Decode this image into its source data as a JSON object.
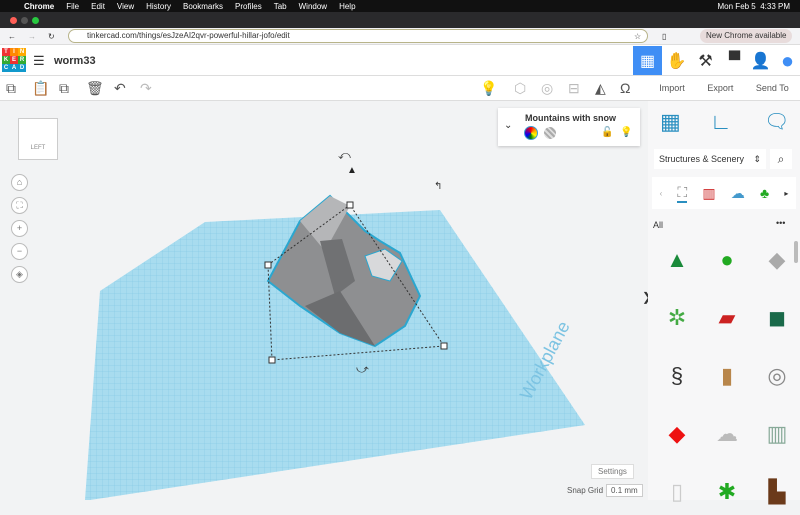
{
  "menubar": {
    "app": "Chrome",
    "items": [
      "File",
      "Edit",
      "View",
      "History",
      "Bookmarks",
      "Profiles",
      "Tab",
      "Window",
      "Help"
    ],
    "datetime": "Mon Feb 5  4:33 PM"
  },
  "browser": {
    "url": "tinkercad.com/things/esJzeAI2qvr-powerful-hillar-jofo/edit",
    "update": "New Chrome available"
  },
  "logo": [
    "T",
    "I",
    "N",
    "K",
    "E",
    "R",
    "C",
    "A",
    "D"
  ],
  "header": {
    "title": "worm33"
  },
  "right_toolbar": {
    "import": "Import",
    "export": "Export",
    "send_to": "Send To"
  },
  "inspector": {
    "name": "Mountains with snow"
  },
  "viewcube": {
    "face": "LEFT"
  },
  "workplane": {
    "label": "Workplane",
    "color": "#a8dcef"
  },
  "panel": {
    "category": "Structures & Scenery",
    "section": "All",
    "more": "•••"
  },
  "footer": {
    "settings": "Settings",
    "snap_label": "Snap Grid",
    "snap_value": "0.1 mm"
  },
  "shapes": [
    "tree-pine",
    "tree-round",
    "rock",
    "pine-snow",
    "brick-wall",
    "grass-block",
    "spring",
    "log",
    "manhole",
    "red-tile",
    "skull-rock",
    "tower",
    "door",
    "palm",
    "chair"
  ]
}
